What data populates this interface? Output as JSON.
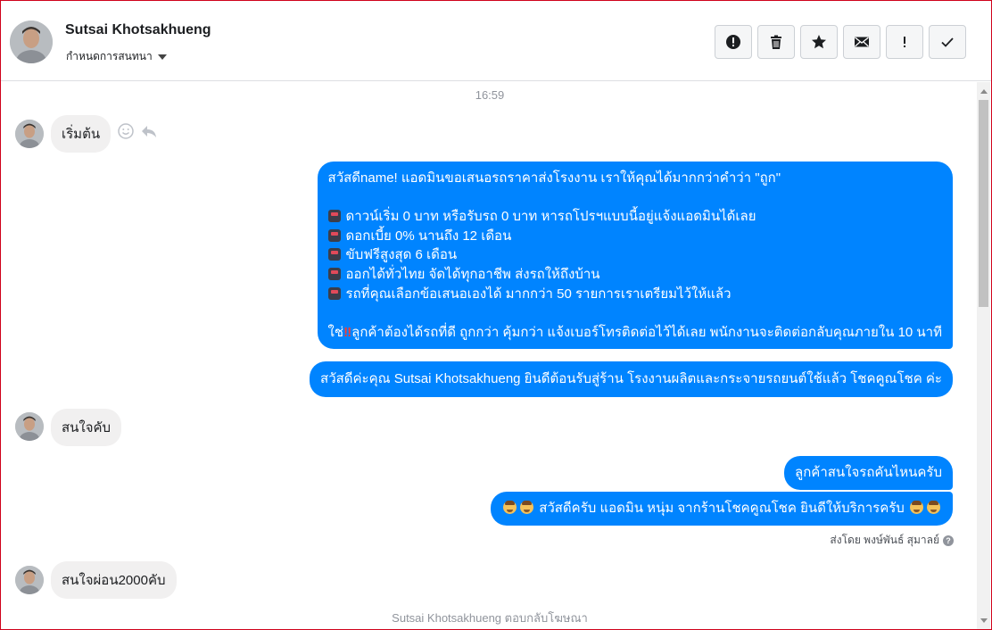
{
  "header": {
    "contact_name": "Sutsai Khotsakhueng",
    "conversation_settings_label": "กำหนดการสนทนา",
    "toolbar": [
      {
        "name": "report-button",
        "icon": "exclamation-circle-icon"
      },
      {
        "name": "delete-button",
        "icon": "trash-icon"
      },
      {
        "name": "star-button",
        "icon": "star-icon"
      },
      {
        "name": "mark-unread-button",
        "icon": "envelope-icon"
      },
      {
        "name": "important-button",
        "icon": "exclamation-icon"
      },
      {
        "name": "done-button",
        "icon": "checkmark-icon"
      }
    ]
  },
  "conversation": {
    "timestamp": "16:59",
    "msg1_in": "เริ่มต้น",
    "msg2_out_lines": [
      "สวัสดีname! แอดมินขอเสนอรถราคาส่งโรงงาน เราให้คุณได้มากกว่าคำว่า \"ถูก\"",
      "",
      "ดาวน์เริ่ม 0 บาท หรือรับรถ 0 บาท หารถโปรฯแบบนี้อยู่แจ้งแอดมินได้เลย",
      "ดอกเบี้ย 0% นานถึง 12 เดือน",
      "ขับฟรีสูงสุด 6 เดือน",
      "ออกได้ทั่วไทย จัดได้ทุกอาชีพ ส่งรถให้ถึงบ้าน",
      "รถที่คุณเลือกข้อเสนอเองได้ มากกว่า 50 รายการเราเตรียมไว้ให้แล้ว",
      "",
      "ใช่",
      "ลูกค้าต้องได้รถที่ดี ถูกกว่า คุ้มกว่า แจ้งเบอร์โทรติดต่อไว้ได้เลย พนักงานจะติดต่อกลับคุณภายใน 10 นาที"
    ],
    "msg3_out": "สวัสดีค่ะคุณ Sutsai Khotsakhueng ยินดีต้อนรับสู่ร้าน โรงงานผลิตและกระจายรถยนต์ใช้แล้ว โชคคูณโชค ค่ะ",
    "msg4_in": "สนใจคับ",
    "msg5_out": "ลูกค้าสนใจรถคันไหนครับ",
    "msg6_out": "สวัสดีครับ แอดมิน หนุ่ม จากร้านโชคคูณโชค ยินดีให้บริการครับ",
    "sent_by": "ส่งโดย พงษ์พันธ์ สุมาลย์",
    "msg7_in": "สนใจผ่อน2000คับ",
    "footer_note": "Sutsai Khotsakhueng ตอบกลับโฆษณา"
  },
  "colors": {
    "outgoing_bubble": "#0084ff",
    "incoming_bubble": "#f1f0f0",
    "border_accent": "#d0021b"
  }
}
